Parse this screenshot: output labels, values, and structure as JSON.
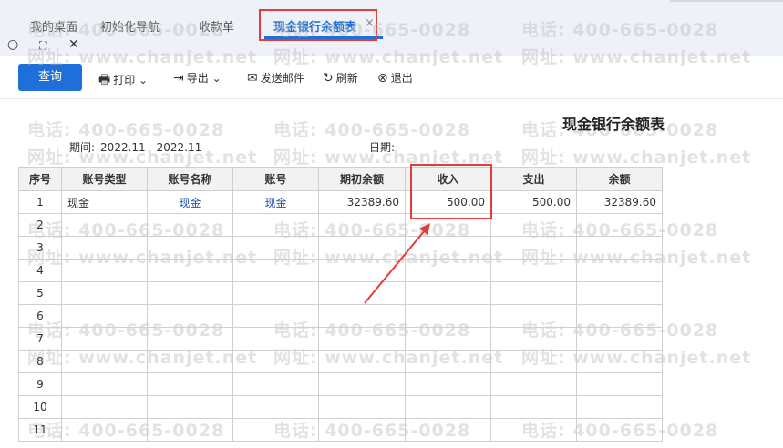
{
  "tabs": [
    {
      "label": "我的桌面"
    },
    {
      "label": "初始化导航"
    },
    {
      "label": "收款单"
    },
    {
      "label": "现金银行余额表",
      "active": true
    }
  ],
  "tab_close_glyph": "×",
  "tab_tools": {
    "zoom_glyph": "○",
    "fullscreen_glyph": "⛶",
    "close_glyph": "✕"
  },
  "toolbar": {
    "query_label": "查询",
    "print_label": "打印",
    "export_label": "导出",
    "email_label": "发送邮件",
    "refresh_label": "刷新",
    "exit_label": "退出"
  },
  "watermark": {
    "phone": "电话: 400-665-0028",
    "site": "网址: www.chanjet.net"
  },
  "report": {
    "title": "现金银行余额表",
    "period_label": "期间:",
    "period_value": "2022.11 - 2022.11",
    "date_label": "日期:"
  },
  "table": {
    "headers": [
      "序号",
      "账号类型",
      "账号名称",
      "账号",
      "期初余额",
      "收入",
      "支出",
      "余额"
    ],
    "rows": [
      [
        "1",
        "现金",
        "现金",
        "现金",
        "32389.60",
        "500.00",
        "500.00",
        "32389.60"
      ],
      [
        "2",
        "",
        "",
        "",
        "",
        "",
        "",
        ""
      ],
      [
        "3",
        "",
        "",
        "",
        "",
        "",
        "",
        ""
      ],
      [
        "4",
        "",
        "",
        "",
        "",
        "",
        "",
        ""
      ],
      [
        "5",
        "",
        "",
        "",
        "",
        "",
        "",
        ""
      ],
      [
        "6",
        "",
        "",
        "",
        "",
        "",
        "",
        ""
      ],
      [
        "7",
        "",
        "",
        "",
        "",
        "",
        "",
        ""
      ],
      [
        "8",
        "",
        "",
        "",
        "",
        "",
        "",
        ""
      ],
      [
        "9",
        "",
        "",
        "",
        "",
        "",
        "",
        ""
      ],
      [
        "10",
        "",
        "",
        "",
        "",
        "",
        "",
        ""
      ],
      [
        "11",
        "",
        "",
        "",
        "",
        "",
        "",
        ""
      ]
    ]
  },
  "colors": {
    "accent": "#1e6fd9",
    "highlight": "#e23c3c"
  },
  "icons": [
    "printer-icon",
    "export-icon",
    "email-icon",
    "refresh-icon",
    "exit-icon",
    "chevron-down-icon",
    "search-icon",
    "fullscreen-icon",
    "close-icon"
  ]
}
